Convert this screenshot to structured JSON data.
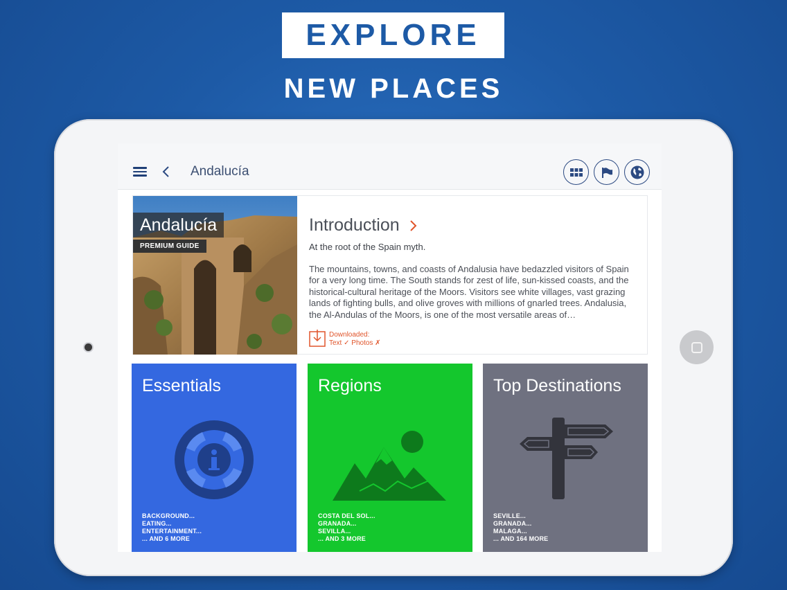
{
  "promo": {
    "headline": "EXPLORE",
    "subheadline": "NEW PLACES"
  },
  "topbar": {
    "title": "Andalucía",
    "buttons": [
      {
        "icon": "grid-icon"
      },
      {
        "icon": "flag-icon"
      },
      {
        "icon": "globe-icon"
      }
    ]
  },
  "hero": {
    "tag": "Andalucía",
    "badge": "PREMIUM GUIDE",
    "intro_title": "Introduction",
    "intro_subtitle": "At the root of the Spain myth.",
    "intro_body": "The mountains, towns, and coasts of Andalusia have bedazzled visitors of Spain for a very long time. The South stands for zest of life, sun-kissed coasts, and the historical-cultural heritage of the Moors. Visitors see white villages, vast grazing lands of fighting bulls, and olive groves with millions of gnarled trees. Andalusia, the Al-Andulas of the Moors, is one of the most versatile areas of…",
    "download_label": "Downloaded:",
    "download_status": "Text ✓ Photos ✗"
  },
  "tiles": [
    {
      "title": "Essentials",
      "color": "#3468e0",
      "icon": "lifebuoy-info-icon",
      "items": [
        "BACKGROUND...",
        "EATING...",
        "ENTERTAINMENT...",
        "... AND 6 MORE"
      ]
    },
    {
      "title": "Regions",
      "color": "#14c72d",
      "icon": "mountains-icon",
      "items": [
        "COSTA DEL SOL...",
        "GRANADA...",
        "SEVILLA...",
        "... AND 3 MORE"
      ]
    },
    {
      "title": "Top Destinations",
      "color": "#6f7180",
      "icon": "signpost-icon",
      "items": [
        "SEVILLE...",
        "GRANADA...",
        "MALAGA...",
        "... AND 164 MORE"
      ]
    }
  ],
  "colors": {
    "background": "#1d5aa6",
    "accent": "#e0542a",
    "nav": "#2c4a82"
  }
}
